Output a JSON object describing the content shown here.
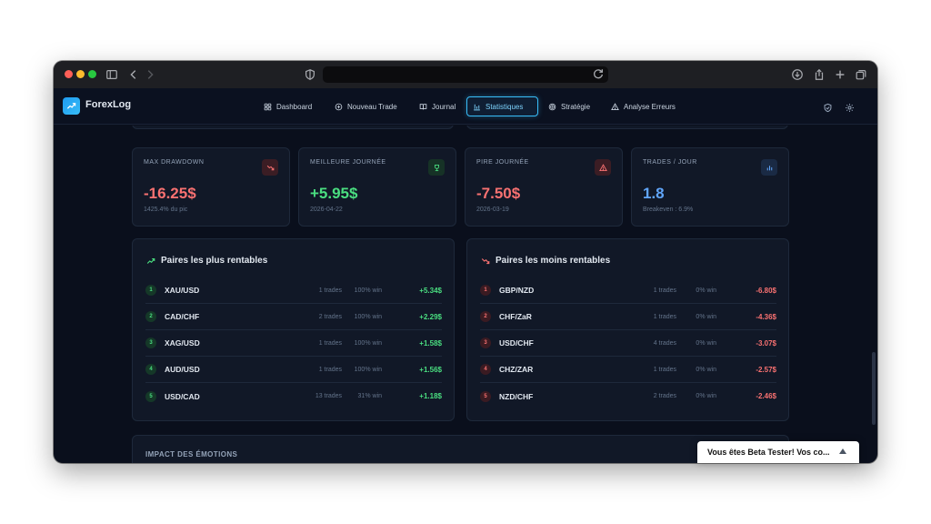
{
  "app": {
    "name": "ForexLog"
  },
  "nav": {
    "items": [
      {
        "label": "Dashboard",
        "icon": "grid-icon"
      },
      {
        "label": "Nouveau Trade",
        "icon": "plus-circle-icon"
      },
      {
        "label": "Journal",
        "icon": "book-icon"
      },
      {
        "label": "Statistiques",
        "icon": "bar-chart-icon",
        "active": true
      },
      {
        "label": "Stratégie",
        "icon": "target-icon"
      },
      {
        "label": "Analyse Erreurs",
        "icon": "warning-icon"
      }
    ]
  },
  "stats": [
    {
      "label": "MAX DRAWDOWN",
      "value": "-16.25$",
      "sub": "1425.4% du pic",
      "color": "#f87171",
      "icon": "trend-down-icon"
    },
    {
      "label": "MEILLEURE JOURNÉE",
      "value": "+5.95$",
      "sub": "2026-04-22",
      "color": "#4ade80",
      "icon": "trophy-icon"
    },
    {
      "label": "PIRE JOURNÉE",
      "value": "-7.50$",
      "sub": "2026-03-19",
      "color": "#f87171",
      "icon": "alert-icon"
    },
    {
      "label": "TRADES / JOUR",
      "value": "1.8",
      "sub": "Breakeven : 6.9%",
      "color": "#60a5fa",
      "icon": "bar-chart-icon"
    }
  ],
  "best_pairs": {
    "title": "Paires les plus rentables",
    "rows": [
      {
        "rank": "1",
        "pair": "XAU/USD",
        "trades": "1 trades",
        "win": "100% win",
        "pnl": "+5.34$"
      },
      {
        "rank": "2",
        "pair": "CAD/CHF",
        "trades": "2 trades",
        "win": "100% win",
        "pnl": "+2.29$"
      },
      {
        "rank": "3",
        "pair": "XAG/USD",
        "trades": "1 trades",
        "win": "100% win",
        "pnl": "+1.58$"
      },
      {
        "rank": "4",
        "pair": "AUD/USD",
        "trades": "1 trades",
        "win": "100% win",
        "pnl": "+1.56$"
      },
      {
        "rank": "5",
        "pair": "USD/CAD",
        "trades": "13 trades",
        "win": "31% win",
        "pnl": "+1.18$"
      }
    ]
  },
  "worst_pairs": {
    "title": "Paires les moins rentables",
    "rows": [
      {
        "rank": "1",
        "pair": "GBP/NZD",
        "trades": "1 trades",
        "win": "0% win",
        "pnl": "-6.80$"
      },
      {
        "rank": "2",
        "pair": "CHF/ZaR",
        "trades": "1 trades",
        "win": "0% win",
        "pnl": "-4.36$"
      },
      {
        "rank": "3",
        "pair": "USD/CHF",
        "trades": "4 trades",
        "win": "0% win",
        "pnl": "-3.07$"
      },
      {
        "rank": "4",
        "pair": "CHZ/ZAR",
        "trades": "1 trades",
        "win": "0% win",
        "pnl": "-2.57$"
      },
      {
        "rank": "5",
        "pair": "NZD/CHF",
        "trades": "2 trades",
        "win": "0% win",
        "pnl": "-2.46$"
      }
    ]
  },
  "emotions": {
    "title": "IMPACT DES ÉMOTIONS"
  },
  "toast": {
    "text": "Vous êtes Beta Tester! Vos co..."
  },
  "colors": {
    "positive": "#4ade80",
    "negative": "#f87171",
    "accent": "#38bdf8"
  }
}
